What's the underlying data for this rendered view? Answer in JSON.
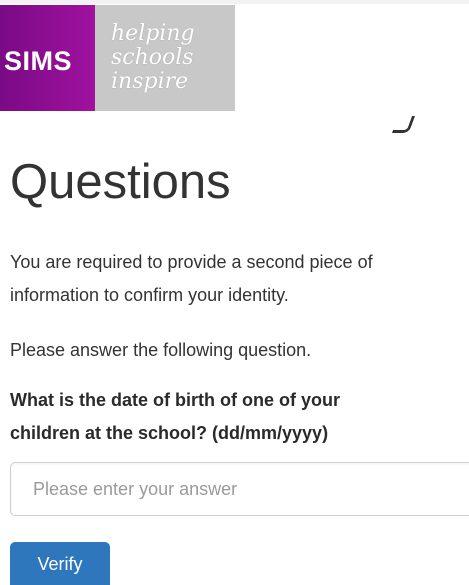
{
  "brand": {
    "logo_text": "SIMS",
    "tagline": [
      "helping",
      "schools",
      "inspire"
    ],
    "primary_color": "#8b0f93",
    "tagline_bg": "#c8c8c8"
  },
  "page": {
    "title": "Questions",
    "intro_line1": "You are required to provide a second piece of",
    "intro_line2": "information to confirm your identity.",
    "instruction": "Please answer the following question."
  },
  "question": {
    "line1": "What is the date of birth of one of your",
    "line2": "children at the school? (dd/mm/yyyy)"
  },
  "form": {
    "answer_placeholder": "Please enter your answer",
    "answer_value": "",
    "verify_label": "Verify",
    "button_color": "#2f77bd"
  }
}
